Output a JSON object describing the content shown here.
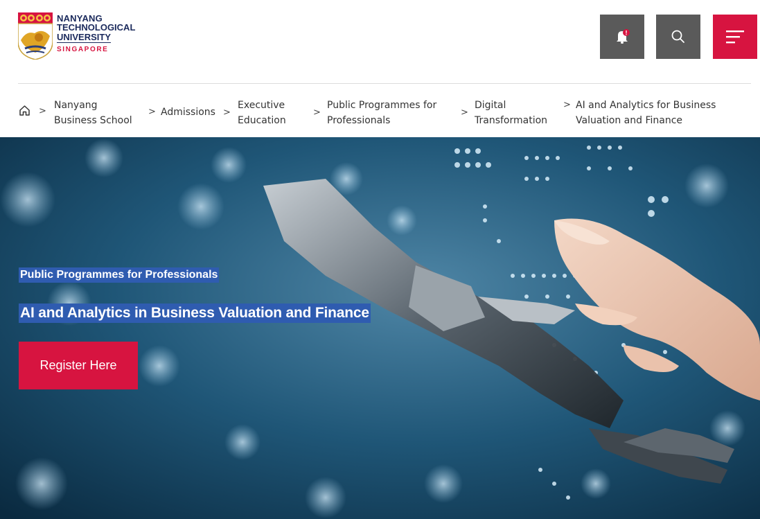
{
  "header": {
    "logo": {
      "line1": "NANYANG",
      "line2": "TECHNOLOGICAL",
      "line3": "UNIVERSITY",
      "line4": "SINGAPORE"
    },
    "icons": {
      "notification": "bell-icon",
      "notification_badge": "!",
      "search": "search-icon",
      "menu": "hamburger-menu-icon"
    },
    "colors": {
      "brand_red": "#d71440",
      "icon_gray": "#5a5a5a",
      "navy": "#1b2a5c"
    }
  },
  "breadcrumb": {
    "home_icon": "home-icon",
    "separator": ">",
    "items": [
      {
        "line1": "Nanyang",
        "line2": "Business School"
      },
      {
        "line1": "Admissions"
      },
      {
        "line1": "Executive",
        "line2": "Education"
      },
      {
        "line1": "Public Programmes for",
        "line2": "Professionals"
      },
      {
        "line1": "Digital",
        "line2": "Transformation"
      },
      {
        "line1": "AI and Analytics for Business",
        "line2": "Valuation and Finance"
      }
    ]
  },
  "hero": {
    "subtitle": "Public Programmes for Professionals",
    "title": "AI and Analytics in Business Valuation and Finance",
    "button_label": "Register Here",
    "image": "robot-and-human-hand-digital-background"
  }
}
